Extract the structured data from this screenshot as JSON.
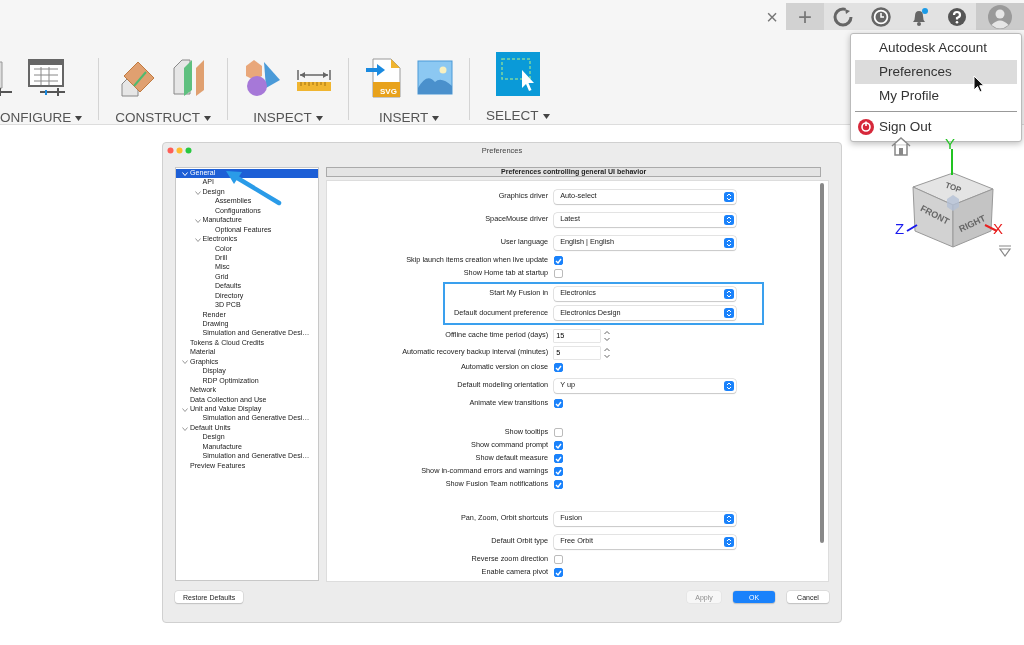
{
  "top_bar": {
    "close_tab": "×",
    "new_tab": "+"
  },
  "toolbar": {
    "groups": [
      {
        "label": "ONFIGURE",
        "kind": "configure"
      },
      {
        "label": "CONSTRUCT",
        "kind": "construct"
      },
      {
        "label": "INSPECT",
        "kind": "inspect"
      },
      {
        "label": "INSERT",
        "kind": "insert",
        "file_type": "SVG"
      },
      {
        "label": "SELECT",
        "kind": "select"
      }
    ]
  },
  "user_menu": {
    "items": [
      {
        "label": "Autodesk Account",
        "kind": "item",
        "selected": false
      },
      {
        "label": "Preferences",
        "kind": "item",
        "selected": true
      },
      {
        "label": "My Profile",
        "kind": "item",
        "selected": false
      },
      {
        "label": "Sign Out",
        "kind": "sign_out",
        "selected": false
      }
    ]
  },
  "view_cube": {
    "faces": [
      "TOP",
      "FRONT",
      "RIGHT"
    ],
    "axes": [
      {
        "label": "Y",
        "color": "#22c322"
      },
      {
        "label": "Z",
        "color": "#1a1aee"
      },
      {
        "label": "X",
        "color": "#e82020"
      }
    ]
  },
  "dialog": {
    "title": "Preferences",
    "tree": [
      {
        "label": "General",
        "selected": true,
        "expanded": true,
        "children": [
          {
            "label": "API",
            "selected": false
          },
          {
            "label": "Design",
            "selected": false,
            "expanded": true,
            "children": [
              {
                "label": "Assemblies",
                "selected": false
              },
              {
                "label": "Configurations",
                "selected": false
              }
            ]
          },
          {
            "label": "Manufacture",
            "selected": false,
            "expanded": true,
            "children": [
              {
                "label": "Optional Features",
                "selected": false
              }
            ]
          },
          {
            "label": "Electronics",
            "selected": false,
            "expanded": true,
            "children": [
              {
                "label": "Color",
                "selected": false
              },
              {
                "label": "Drill",
                "selected": false
              },
              {
                "label": "Misc",
                "selected": false
              },
              {
                "label": "Grid",
                "selected": false
              },
              {
                "label": "Defaults",
                "selected": false
              },
              {
                "label": "Directory",
                "selected": false
              },
              {
                "label": "3D PCB",
                "selected": false
              }
            ]
          },
          {
            "label": "Render",
            "selected": false
          },
          {
            "label": "Drawing",
            "selected": false
          },
          {
            "label": "Simulation and Generative Desi…",
            "selected": false
          }
        ]
      },
      {
        "label": "Tokens & Cloud Credits",
        "selected": false
      },
      {
        "label": "Material",
        "selected": false
      },
      {
        "label": "Graphics",
        "selected": false,
        "expanded": true,
        "children": [
          {
            "label": "Display",
            "selected": false
          },
          {
            "label": "RDP Optimization",
            "selected": false
          }
        ]
      },
      {
        "label": "Network",
        "selected": false
      },
      {
        "label": "Data Collection and Use",
        "selected": false
      },
      {
        "label": "Unit and Value Display",
        "selected": false,
        "expanded": true,
        "children": [
          {
            "label": "Simulation and Generative Desi…",
            "selected": false
          }
        ]
      },
      {
        "label": "Default Units",
        "selected": false,
        "expanded": true,
        "children": [
          {
            "label": "Design",
            "selected": false
          },
          {
            "label": "Manufacture",
            "selected": false
          },
          {
            "label": "Simulation and Generative Desi…",
            "selected": false
          }
        ]
      },
      {
        "label": "Preview Features",
        "selected": false
      }
    ],
    "header": "Preferences controlling general UI behavior",
    "groups": [
      {
        "highlighted": false,
        "rows": [
          {
            "kind": "select",
            "label": "Graphics driver",
            "value": "Auto-select"
          },
          {
            "kind": "select",
            "label": "SpaceMouse driver",
            "value": "Latest"
          },
          {
            "kind": "select",
            "label": "User language",
            "value": "English | English"
          },
          {
            "kind": "checkbox",
            "label": "Skip launch items creation when live update",
            "checked": true
          },
          {
            "kind": "checkbox",
            "label": "Show Home tab at startup",
            "checked": false
          }
        ]
      },
      {
        "highlighted": true,
        "rows": [
          {
            "kind": "select",
            "label": "Start My Fusion in",
            "value": "Electronics"
          },
          {
            "kind": "select",
            "label": "Default document preference",
            "value": "Electronics Design"
          }
        ]
      },
      {
        "highlighted": false,
        "rows": [
          {
            "kind": "spin",
            "label": "Offline cache time period (days)",
            "value": "15"
          },
          {
            "kind": "spin",
            "label": "Automatic recovery backup interval (minutes)",
            "value": "5"
          },
          {
            "kind": "checkbox",
            "label": "Automatic version on close",
            "checked": true
          },
          {
            "kind": "select",
            "label": "Default modeling orientation",
            "value": "Y up"
          },
          {
            "kind": "checkbox",
            "label": "Animate view transitions",
            "checked": true
          }
        ]
      },
      {
        "highlighted": false,
        "rows": [
          {
            "kind": "checkbox",
            "label": "Show tooltips",
            "checked": false
          },
          {
            "kind": "checkbox",
            "label": "Show command prompt",
            "checked": true
          },
          {
            "kind": "checkbox",
            "label": "Show default measure",
            "checked": true
          },
          {
            "kind": "checkbox",
            "label": "Show in-command errors and warnings",
            "checked": true
          },
          {
            "kind": "checkbox",
            "label": "Show Fusion Team notifications",
            "checked": true
          }
        ]
      },
      {
        "highlighted": false,
        "rows": [
          {
            "kind": "select",
            "label": "Pan, Zoom, Orbit shortcuts",
            "value": "Fusion"
          },
          {
            "kind": "select",
            "label": "Default Orbit type",
            "value": "Free Orbit"
          },
          {
            "kind": "checkbox",
            "label": "Reverse zoom direction",
            "checked": false
          },
          {
            "kind": "checkbox",
            "label": "Enable camera pivot",
            "checked": true
          }
        ]
      }
    ],
    "restore_button": "Restore Defaults",
    "buttons": [
      {
        "label": "Apply",
        "kind": "secondary",
        "disabled": true
      },
      {
        "label": "OK",
        "kind": "primary",
        "disabled": false
      },
      {
        "label": "Cancel",
        "kind": "secondary",
        "disabled": false
      }
    ]
  }
}
